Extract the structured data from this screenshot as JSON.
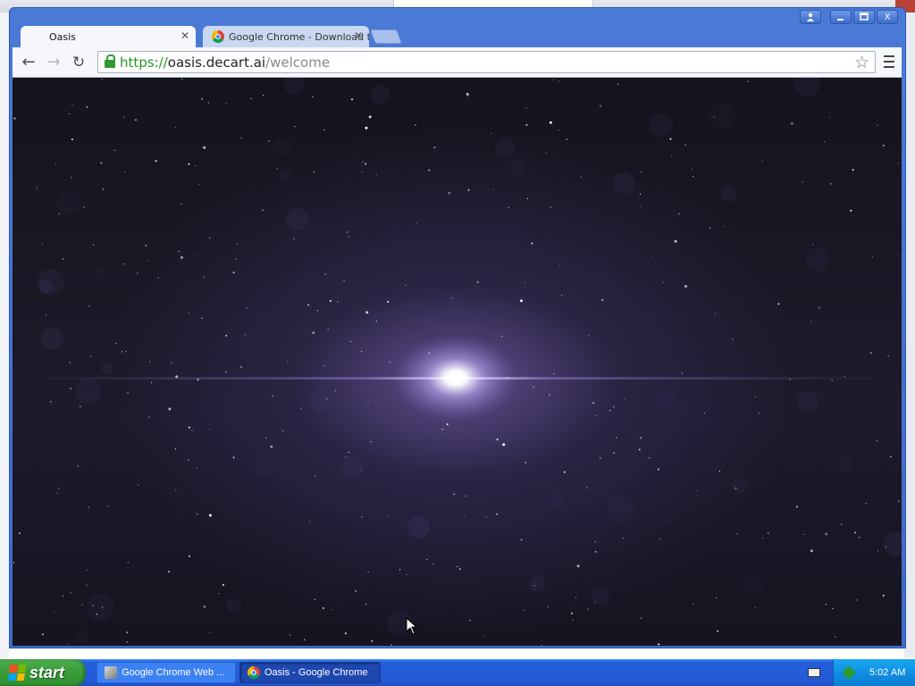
{
  "browser": {
    "tabs": [
      {
        "title": "Oasis",
        "active": true
      },
      {
        "title": "Google Chrome - Download t",
        "active": false
      }
    ],
    "window_controls": {
      "profile_icon": "person-icon",
      "minimize_icon": "minimize-icon",
      "maximize_icon": "maximize-icon",
      "close_label": "X"
    },
    "toolbar": {
      "back_icon": "←",
      "forward_icon": "→",
      "reload_icon": "↻",
      "star_icon": "☆"
    },
    "address": {
      "scheme": "https://",
      "host": "oasis.decart.ai",
      "path": "/welcome",
      "secure": true,
      "scheme_color": "#279627"
    }
  },
  "page": {
    "content": "starfield with central bright star",
    "star_color": "#ffffff",
    "glow_color": "#b9a6ff"
  },
  "taskbar": {
    "start_label": "start",
    "items": [
      {
        "label": "Google Chrome Web ...",
        "icon": "installer-icon",
        "active": false
      },
      {
        "label": "Oasis - Google Chrome",
        "icon": "chrome-icon",
        "active": true
      }
    ],
    "tray": {
      "keyboard_icon": "keyboard-icon",
      "network_icon": "network-icon",
      "clock": "5:02 AM"
    }
  }
}
